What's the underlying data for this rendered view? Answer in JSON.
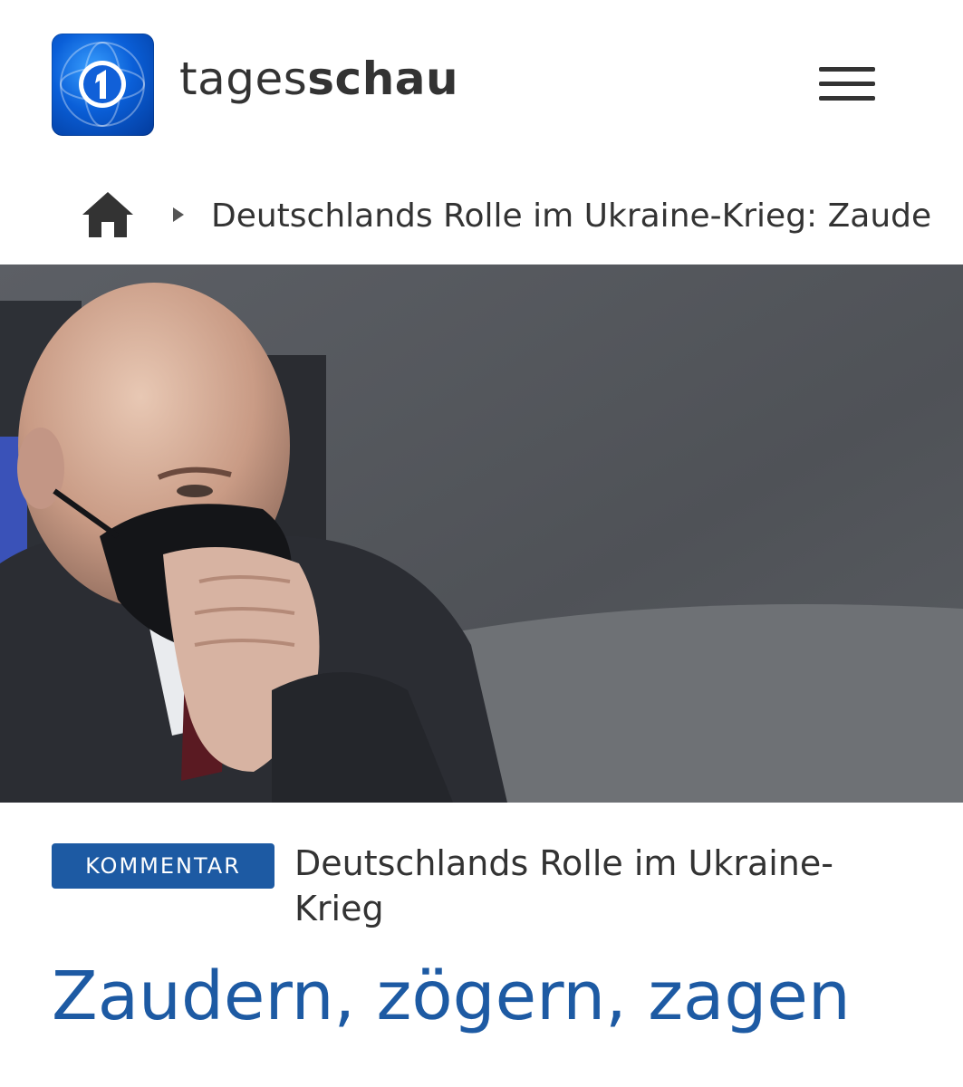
{
  "header": {
    "brand_part1": "tages",
    "brand_part2": "schau",
    "logo_icon": "ard-1-logo-icon",
    "menu_icon": "hamburger-menu-icon"
  },
  "breadcrumb": {
    "home_icon": "home-icon",
    "separator_icon": "triangle-right-icon",
    "current": "Deutschlands Rolle im Ukraine-Krieg: Zaude"
  },
  "article": {
    "tag": "KOMMENTAR",
    "topline": "Deutschlands Rolle im Ukraine-Krieg",
    "headline": "Zaudern, zögern, zagen"
  },
  "colors": {
    "accent": "#1d5aa3",
    "text": "#333333"
  }
}
